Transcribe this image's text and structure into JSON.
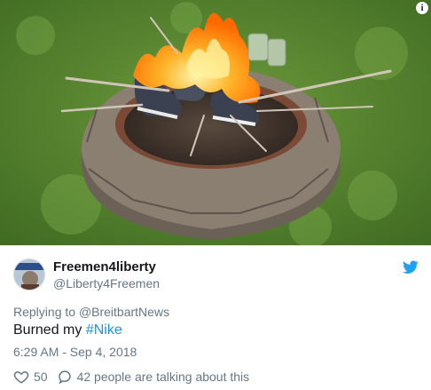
{
  "tweet": {
    "display_name": "Freemen4liberty",
    "handle": "@Liberty4Freemen",
    "replying_prefix": "Replying to",
    "replying_to": "@BreitbartNews",
    "text_prefix": "Burned my",
    "hashtag": "#Nike",
    "timestamp": "6:29 AM - Sep 4, 2018",
    "likes": "50",
    "conversation": "42 people are talking about this"
  },
  "icons": {
    "info": "i",
    "bird": "twitter-bird-icon",
    "heart": "heart-icon",
    "comment": "comment-icon"
  },
  "colors": {
    "link": "#1b95e0",
    "secondary_text": "#657786",
    "primary_text": "#14171a"
  }
}
